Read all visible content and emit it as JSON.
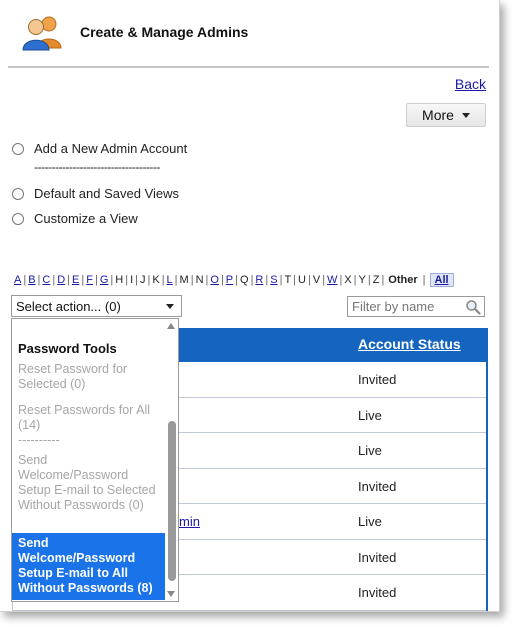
{
  "header": {
    "title": "Create & Manage Admins",
    "icon": "admins-users-icon"
  },
  "nav": {
    "back_label": "Back",
    "more_label": "More"
  },
  "options": {
    "add_admin": "Add a New Admin Account",
    "separator": "------------------------------------",
    "default_views": "Default and Saved Views",
    "customize_view": "Customize a View"
  },
  "alphabet": {
    "letters": [
      {
        "label": "A",
        "link": true
      },
      {
        "label": "B",
        "link": true
      },
      {
        "label": "C",
        "link": true
      },
      {
        "label": "D",
        "link": true
      },
      {
        "label": "E",
        "link": true
      },
      {
        "label": "F",
        "link": true
      },
      {
        "label": "G",
        "link": true
      },
      {
        "label": "H",
        "link": false
      },
      {
        "label": "I",
        "link": false
      },
      {
        "label": "J",
        "link": false
      },
      {
        "label": "K",
        "link": false
      },
      {
        "label": "L",
        "link": true
      },
      {
        "label": "M",
        "link": false
      },
      {
        "label": "N",
        "link": false
      },
      {
        "label": "O",
        "link": true
      },
      {
        "label": "P",
        "link": true
      },
      {
        "label": "Q",
        "link": false
      },
      {
        "label": "R",
        "link": true
      },
      {
        "label": "S",
        "link": true
      },
      {
        "label": "T",
        "link": false
      },
      {
        "label": "U",
        "link": false
      },
      {
        "label": "V",
        "link": false
      },
      {
        "label": "W",
        "link": true
      },
      {
        "label": "X",
        "link": false
      },
      {
        "label": "Y",
        "link": false
      },
      {
        "label": "Z",
        "link": false
      }
    ],
    "other_label": "Other",
    "all_label": "All"
  },
  "controls": {
    "select_action_value": "Select action... (0)",
    "filter_placeholder": "Filter by name"
  },
  "dropdown": {
    "group_label": "Password Tools",
    "items": [
      {
        "label": "Reset Password for Selected (0)",
        "state": "disabled"
      },
      {
        "label": "Reset Passwords for All (14)",
        "state": "disabled"
      },
      {
        "label": "----------",
        "state": "disabled"
      },
      {
        "label": "Send Welcome/Password Setup E-mail to Selected Without Passwords (0)",
        "state": "disabled"
      },
      {
        "label": "Send Welcome/Password Setup E-mail to All Without Passwords (8)",
        "state": "selected"
      }
    ]
  },
  "table": {
    "status_header": "Account Status",
    "rows": [
      {
        "name_fragment": "",
        "status": "Invited"
      },
      {
        "name_fragment": "",
        "status": "Live"
      },
      {
        "name_fragment": "",
        "status": "Live"
      },
      {
        "name_fragment": "",
        "status": "Invited"
      },
      {
        "name_fragment": "min",
        "status": "Live"
      },
      {
        "name_fragment": "",
        "status": "Invited"
      },
      {
        "name_fragment": "",
        "status": "Invited"
      }
    ]
  },
  "colors": {
    "accent": "#1565c0",
    "selection": "#1a73e8",
    "link": "#1a1aa6"
  }
}
